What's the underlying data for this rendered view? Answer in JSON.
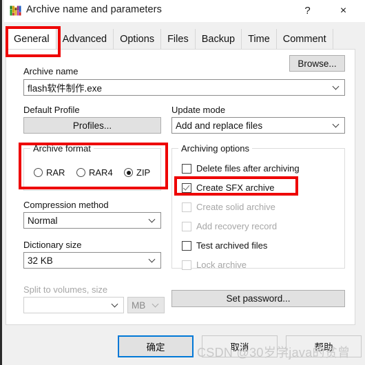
{
  "window": {
    "title": "Archive name and parameters",
    "icon": "winrar-books-icon",
    "help_button": "?",
    "close_button": "×"
  },
  "tabs": [
    {
      "label": "General",
      "active": true
    },
    {
      "label": "Advanced",
      "active": false
    },
    {
      "label": "Options",
      "active": false
    },
    {
      "label": "Files",
      "active": false
    },
    {
      "label": "Backup",
      "active": false
    },
    {
      "label": "Time",
      "active": false
    },
    {
      "label": "Comment",
      "active": false
    }
  ],
  "archive_name": {
    "label": "Archive name",
    "value": "flash软件制作.exe",
    "browse_label": "Browse..."
  },
  "default_profile": {
    "label": "Default Profile",
    "button_label": "Profiles..."
  },
  "update_mode": {
    "label": "Update mode",
    "value": "Add and replace files"
  },
  "archive_format": {
    "title": "Archive format",
    "options": [
      {
        "label": "RAR",
        "checked": false
      },
      {
        "label": "RAR4",
        "checked": false
      },
      {
        "label": "ZIP",
        "checked": true
      }
    ]
  },
  "compression_method": {
    "label": "Compression method",
    "value": "Normal"
  },
  "dictionary_size": {
    "label": "Dictionary size",
    "value": "32 KB"
  },
  "split_volumes": {
    "label": "Split to volumes, size",
    "value": "",
    "unit": "MB",
    "disabled": true
  },
  "archiving_options": {
    "title": "Archiving options",
    "items": [
      {
        "label": "Delete files after archiving",
        "checked": false,
        "disabled": false
      },
      {
        "label": "Create SFX archive",
        "checked": true,
        "disabled": false
      },
      {
        "label": "Create solid archive",
        "checked": false,
        "disabled": true
      },
      {
        "label": "Add recovery record",
        "checked": false,
        "disabled": true
      },
      {
        "label": "Test archived files",
        "checked": false,
        "disabled": false
      },
      {
        "label": "Lock archive",
        "checked": false,
        "disabled": true
      }
    ]
  },
  "set_password": {
    "label": "Set password..."
  },
  "footer": {
    "ok_label": "确定",
    "cancel_label": "取消",
    "help_label": "帮助"
  },
  "watermark": {
    "text": "CSDN @30岁学java的贫曾"
  },
  "annotations": {
    "accent_color": "#ee0000",
    "highlighted": [
      "General tab",
      "Archive format",
      "Create SFX archive"
    ]
  }
}
